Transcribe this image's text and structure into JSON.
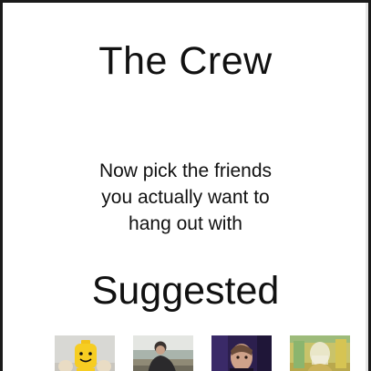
{
  "header": {
    "title": "The Crew"
  },
  "main": {
    "prompt_lines": [
      "Now pick the friends",
      "you actually want to",
      "hang out with"
    ],
    "section_heading": "Suggested"
  },
  "suggested": {
    "friends": [
      {
        "avatar_icon": "lego-figure-avatar"
      },
      {
        "avatar_icon": "person-outdoors-avatar"
      },
      {
        "avatar_icon": "person-portrait-avatar"
      },
      {
        "avatar_icon": "person-colorful-avatar"
      }
    ]
  }
}
